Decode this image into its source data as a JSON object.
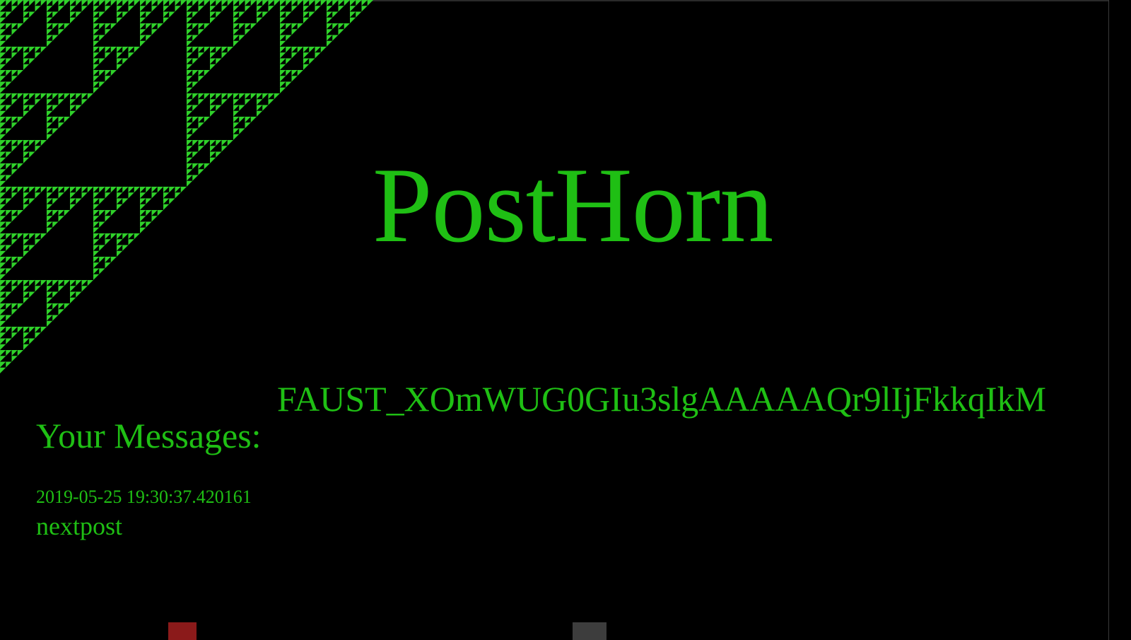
{
  "header": {
    "title": "PostHorn"
  },
  "flag": {
    "text": "FAUST_XOmWUG0GIu3slgAAAAAQr9lIjFkkqIkM"
  },
  "messages_section": {
    "heading": "Your Messages:",
    "items": [
      {
        "timestamp": "2019-05-25 19:30:37.420161",
        "text": "nextpost"
      }
    ]
  },
  "colors": {
    "background": "#000000",
    "accent": "#1fbf14",
    "fractal": "#2fd12a"
  },
  "decoration": {
    "pattern": "sierpinski-triangle"
  }
}
